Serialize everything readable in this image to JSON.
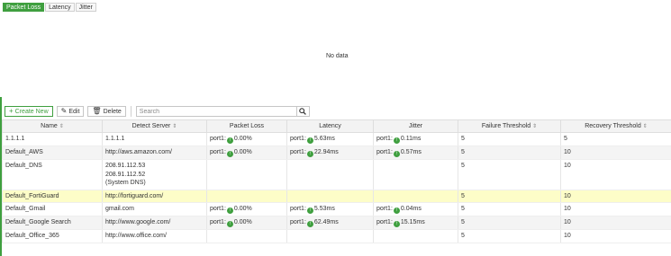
{
  "tabs": [
    "Packet Loss",
    "Latency",
    "Jitter"
  ],
  "active_tab": "Packet Loss",
  "chart": {
    "empty_text": "No data"
  },
  "toolbar": {
    "create_label": "Create New",
    "edit_label": "Edit",
    "delete_label": "Delete",
    "search_placeholder": "Search"
  },
  "colors": {
    "accent": "#3f9f3f",
    "selected_row": "#fdfdc8"
  },
  "table": {
    "columns": [
      "Name",
      "Detect Server",
      "Packet Loss",
      "Latency",
      "Jitter",
      "Failure Threshold",
      "Recovery Threshold"
    ],
    "rows": [
      {
        "name": "1.1.1.1",
        "server": [
          "1.1.1.1"
        ],
        "packet_loss": {
          "port": "port1:",
          "value": "0.00%"
        },
        "latency": {
          "port": "port1:",
          "value": "5.63ms"
        },
        "jitter": {
          "port": "port1:",
          "value": "0.11ms"
        },
        "failure": "5",
        "recovery": "5"
      },
      {
        "name": "Default_AWS",
        "server": [
          "http://aws.amazon.com/"
        ],
        "packet_loss": {
          "port": "port1:",
          "value": "0.00%"
        },
        "latency": {
          "port": "port1:",
          "value": "22.94ms"
        },
        "jitter": {
          "port": "port1:",
          "value": "0.57ms"
        },
        "failure": "5",
        "recovery": "10"
      },
      {
        "name": "Default_DNS",
        "server": [
          "208.91.112.53",
          "208.91.112.52",
          "(System DNS)"
        ],
        "packet_loss": null,
        "latency": null,
        "jitter": null,
        "failure": "5",
        "recovery": "10"
      },
      {
        "name": "Default_FortiGuard",
        "server": [
          "http://fortiguard.com/"
        ],
        "packet_loss": null,
        "latency": null,
        "jitter": null,
        "failure": "5",
        "recovery": "10",
        "selected": true
      },
      {
        "name": "Default_Gmail",
        "server": [
          "gmail.com"
        ],
        "packet_loss": {
          "port": "port1:",
          "value": "0.00%"
        },
        "latency": {
          "port": "port1:",
          "value": "5.53ms"
        },
        "jitter": {
          "port": "port1:",
          "value": "0.04ms"
        },
        "failure": "5",
        "recovery": "10"
      },
      {
        "name": "Default_Google Search",
        "server": [
          "http://www.google.com/"
        ],
        "packet_loss": {
          "port": "port1:",
          "value": "0.00%"
        },
        "latency": {
          "port": "port1:",
          "value": "62.49ms"
        },
        "jitter": {
          "port": "port1:",
          "value": "15.15ms"
        },
        "failure": "5",
        "recovery": "10"
      },
      {
        "name": "Default_Office_365",
        "server": [
          "http://www.office.com/"
        ],
        "packet_loss": null,
        "latency": null,
        "jitter": null,
        "failure": "5",
        "recovery": "10"
      }
    ]
  }
}
